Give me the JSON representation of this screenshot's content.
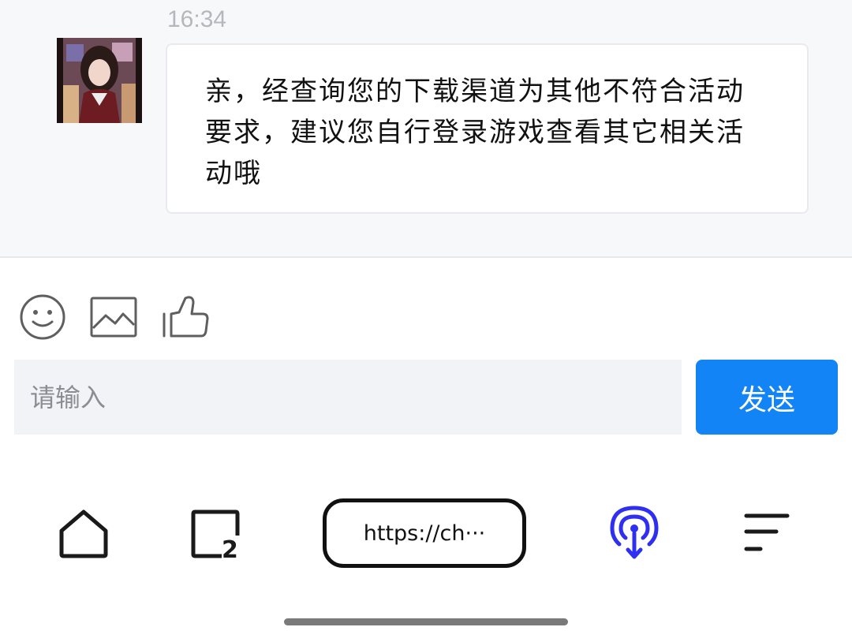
{
  "chat": {
    "timestamp": "16:34",
    "message": "亲，经查询您的下载渠道为其他不符合活动要求，建议您自行登录游戏查看其它相关活动哦"
  },
  "toolbar": {
    "icons": [
      "emoji-icon",
      "image-icon",
      "thumbs-up-icon"
    ]
  },
  "composer": {
    "placeholder": "请输入",
    "send_label": "发送"
  },
  "browser_nav": {
    "url_display": "https://ch···",
    "tab_count": "2",
    "accent_color": "#2e2ff0"
  }
}
